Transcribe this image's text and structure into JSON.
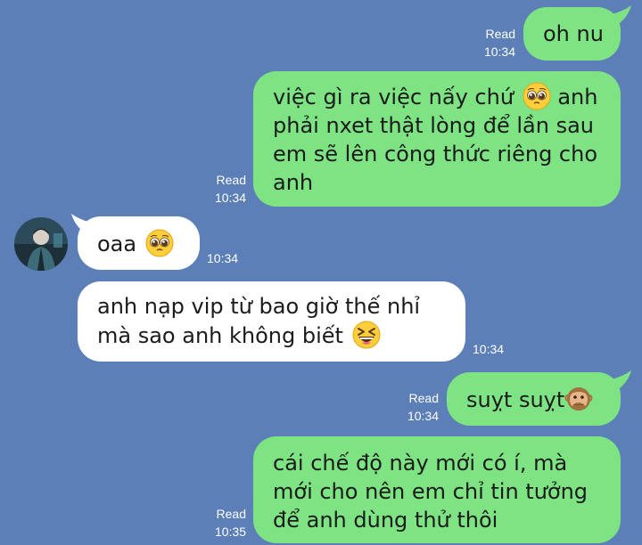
{
  "messages": [
    {
      "text": "oh nu",
      "read": "Read",
      "time": "10:34"
    },
    {
      "text": "việc gì ra việc nấy chứ",
      "emoji": "pleading-face",
      "text2": "anh phải nxet thật lòng để lần sau em sẽ lên công thức riêng cho anh",
      "read": "Read",
      "time": "10:34"
    },
    {
      "text": "oaa",
      "emoji": "pleading-face",
      "time": "10:34"
    },
    {
      "text": "anh nạp vip từ bao giờ thế nhỉ mà sao anh không biết",
      "emoji": "laughing-squint-face",
      "time": "10:34"
    },
    {
      "text": "suỵt suỵt",
      "emoji": "speak-no-evil-monkey",
      "read": "Read",
      "time": "10:34"
    },
    {
      "text": "cái chế độ này mới có í, mà mới cho nên em chỉ tin tưởng để anh dùng thử thôi",
      "read": "Read",
      "time": "10:35"
    }
  ],
  "colors": {
    "background": "#5b7fb6",
    "outgoing_bubble": "#7de383",
    "incoming_bubble": "#ffffff"
  }
}
